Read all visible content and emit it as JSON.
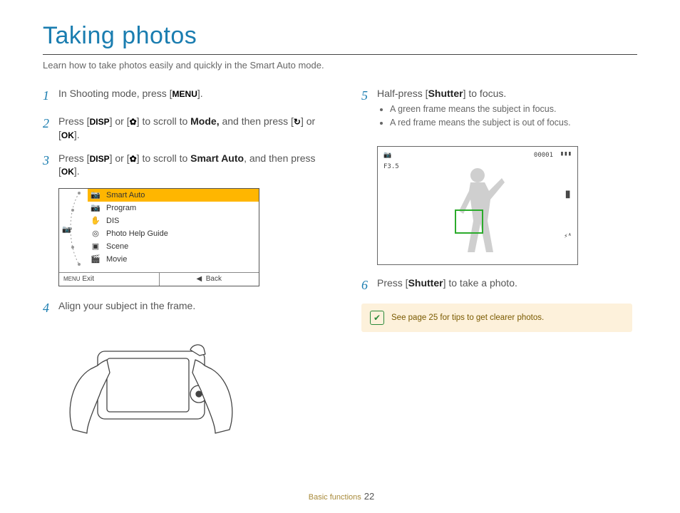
{
  "title": "Taking photos",
  "intro_a": "Learn how to take photos easily and quickly in the ",
  "intro_mode": "Smart Auto",
  "intro_b": " mode.",
  "steps": {
    "s1": {
      "n": "1",
      "a": "In Shooting mode, press [",
      "btn": "MENU",
      "b": "]."
    },
    "s2": {
      "n": "2",
      "a": "Press [",
      "btn1": "DISP",
      "b": "] or [",
      "c": "] to scroll to ",
      "bold": "Mode,",
      "d": " and then press [",
      "e": "] or [",
      "btn2": "OK",
      "f": "]."
    },
    "s3": {
      "n": "3",
      "a": "Press [",
      "btn1": "DISP",
      "b": "] or [",
      "c": "] to scroll to ",
      "bold": "Smart Auto",
      "d": ", and then press [",
      "btn2": "OK",
      "e": "]."
    },
    "s4": {
      "n": "4",
      "text": "Align your subject in the frame."
    },
    "s5": {
      "n": "5",
      "a": "Half-press [",
      "bold": "Shutter",
      "b": "] to focus.",
      "bul1": "A green frame means the subject in focus.",
      "bul2": "A red frame means the subject is out of focus."
    },
    "s6": {
      "n": "6",
      "a": "Press [",
      "bold": "Shutter",
      "b": "] to take a photo."
    }
  },
  "menu": {
    "items": [
      "Smart Auto",
      "Program",
      "DIS",
      "Photo Help Guide",
      "Scene",
      "Movie"
    ],
    "exit": "Exit",
    "back": "Back",
    "backArrow": "◀"
  },
  "lcd": {
    "fnum": "F3.5",
    "counter": "00001"
  },
  "tip": "See page 25 for tips to get clearer photos.",
  "footer": {
    "section": "Basic functions",
    "page": "22"
  }
}
